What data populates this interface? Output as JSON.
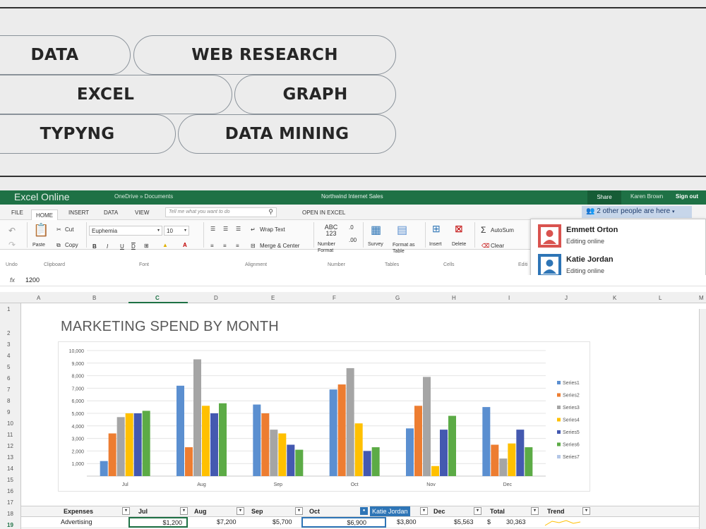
{
  "tags": [
    "DATA",
    "WEB RESEARCH",
    "EXCEL",
    "GRAPH",
    "TYPYNG",
    "DATA MINING"
  ],
  "excel": {
    "app_title": "Excel Online",
    "breadcrumb": "OneDrive » Documents",
    "doc_title": "Northwind Internet Sales",
    "share": "Share",
    "user": "Karen Brown",
    "signout": "Sign out",
    "menu": [
      "FILE",
      "HOME",
      "INSERT",
      "DATA",
      "VIEW"
    ],
    "tell_me": "Tell me what you want to do",
    "open_in_excel": "OPEN IN EXCEL",
    "others_editing": "2 other people are here",
    "ribbon": {
      "undo": "Undo",
      "clipboard": "Clipboard",
      "font_group": "Font",
      "alignment": "Alignment",
      "number_group": "Number",
      "tables": "Tables",
      "cells": "Cells",
      "editing": "Editi",
      "paste": "Paste",
      "cut": "Cut",
      "copy": "Copy",
      "font_name": "Euphemia",
      "font_size": "10",
      "wrap_text": "Wrap Text",
      "merge_center": "Merge & Center",
      "number_format": "Number Format",
      "abc": "ABC 123",
      "survey": "Survey",
      "format_table": "Format as Table",
      "insert": "Insert",
      "delete": "Delete",
      "autosum": "AutoSum",
      "clear": "Clear"
    },
    "collaborators": [
      {
        "name": "Emmett Orton",
        "status": "Editing online",
        "color": "#d9534f"
      },
      {
        "name": "Katie Jordan",
        "status": "Editing online",
        "color": "#2e75b6"
      }
    ],
    "formula_value": "1200",
    "fx": "fx",
    "columns": [
      "A",
      "B",
      "C",
      "D",
      "E",
      "F",
      "G",
      "H",
      "I",
      "J",
      "K",
      "L",
      "M"
    ],
    "rows": [
      "1",
      "2",
      "3",
      "4",
      "5",
      "6",
      "7",
      "8",
      "9",
      "10",
      "11",
      "12",
      "13",
      "14",
      "15",
      "16",
      "17",
      "18",
      "19"
    ],
    "table_header": [
      "Expenses",
      "Jul",
      "Aug",
      "Sep",
      "Oct",
      "Katie Jordan",
      "Dec",
      "Total",
      "Trend"
    ],
    "table_row": [
      "Advertising",
      "$1,200",
      "$7,200",
      "$5,700",
      "$6,900",
      "$3,800",
      "$5,563",
      "$",
      "30,363"
    ]
  },
  "chart_data": {
    "type": "bar",
    "title": "MARKETING SPEND BY MONTH",
    "categories": [
      "Jul",
      "Aug",
      "Sep",
      "Oct",
      "Nov",
      "Dec"
    ],
    "ylim": [
      0,
      10000
    ],
    "yticks": [
      "1,000",
      "2,000",
      "3,000",
      "4,000",
      "5,000",
      "6,000",
      "7,000",
      "8,000",
      "9,000",
      "10,000"
    ],
    "legend_position": "right",
    "grid": true,
    "series": [
      {
        "name": "Series1",
        "color": "#5b8fd0",
        "values": [
          1200,
          7200,
          5700,
          6900,
          3800,
          5500
        ]
      },
      {
        "name": "Series2",
        "color": "#ed7d31",
        "values": [
          3400,
          2300,
          5000,
          7300,
          5600,
          2500
        ]
      },
      {
        "name": "Series3",
        "color": "#a5a5a5",
        "values": [
          4700,
          9300,
          3700,
          8600,
          7900,
          1400
        ]
      },
      {
        "name": "Series4",
        "color": "#ffc000",
        "values": [
          5000,
          5600,
          3400,
          4200,
          800,
          2600
        ]
      },
      {
        "name": "Series5",
        "color": "#4459b0",
        "values": [
          5000,
          5000,
          2500,
          2000,
          3700,
          3700
        ]
      },
      {
        "name": "Series6",
        "color": "#5cab46",
        "values": [
          5200,
          5800,
          2100,
          2300,
          4800,
          2300
        ]
      },
      {
        "name": "Series7",
        "color": "#b4c7e7",
        "values": [
          0,
          0,
          0,
          0,
          0,
          0
        ]
      }
    ]
  }
}
